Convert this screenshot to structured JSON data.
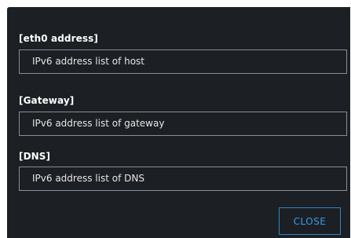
{
  "dialog": {
    "fields": [
      {
        "label": "[eth0 address]",
        "value": "IPv6 address list of host"
      },
      {
        "label": "[Gateway]",
        "value": "IPv6 address list of gateway"
      },
      {
        "label": "[DNS]",
        "value": "IPv6 address list of DNS"
      }
    ],
    "close_label": "CLOSE"
  },
  "colors": {
    "background": "#1c1f23",
    "field_border": "#8a8f96",
    "accent": "#3d9be9"
  }
}
